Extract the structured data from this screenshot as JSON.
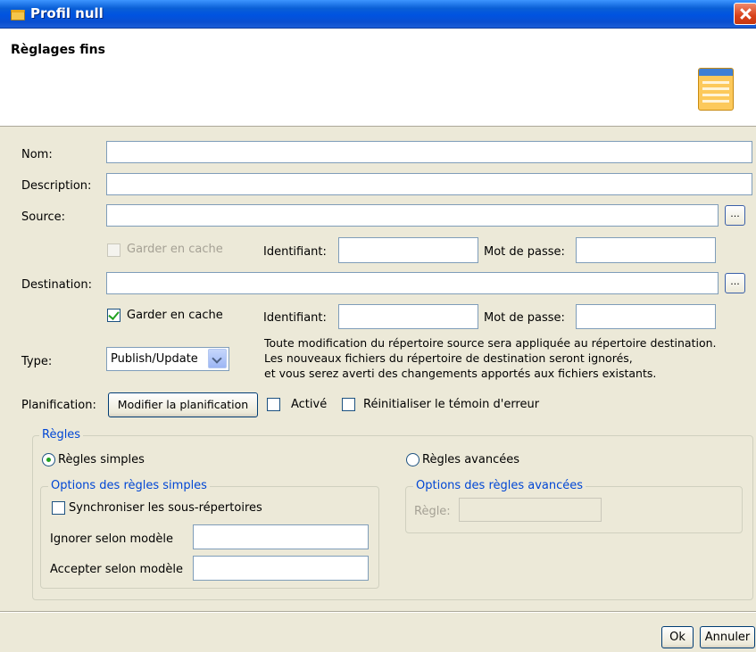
{
  "window": {
    "title": "Profil null"
  },
  "header": {
    "title": "Règlages fins",
    "icon": "profile-settings-icon"
  },
  "form": {
    "name_label": "Nom:",
    "name_value": "",
    "description_label": "Description:",
    "description_value": "",
    "source_label": "Source:",
    "source_value": "",
    "source_browse": "...",
    "source_cache_label": "Garder en cache",
    "source_cache_checked": false,
    "source_cache_enabled": false,
    "source_id_label": "Identifiant:",
    "source_id_value": "",
    "source_pwd_label": "Mot de passe:",
    "source_pwd_value": "",
    "destination_label": "Destination:",
    "destination_value": "",
    "destination_browse": "...",
    "dest_cache_label": "Garder en cache",
    "dest_cache_checked": true,
    "dest_id_label": "Identifiant:",
    "dest_id_value": "",
    "dest_pwd_label": "Mot de passe:",
    "dest_pwd_value": "",
    "type_label": "Type:",
    "type_value": "Publish/Update",
    "type_desc_1": "Toute modification du répertoire source sera appliquée au répertoire destination.",
    "type_desc_2": "Les nouveaux fichiers du répertoire de destination seront ignorés,",
    "type_desc_3": "et vous serez averti des changements apportés aux fichiers existants.",
    "schedule_label": "Planification:",
    "schedule_button": "Modifier la planification",
    "enabled_label": "Activé",
    "enabled_checked": false,
    "reset_label": "Réinitialiser le témoin d'erreur",
    "reset_checked": false
  },
  "rules": {
    "group_label": "Règles",
    "simple_radio": "Règles simples",
    "simple_selected": true,
    "advanced_radio": "Règles avancées",
    "advanced_selected": false,
    "simple_options": {
      "group_label": "Options des règles simples",
      "sync_label": "Synchroniser les sous-répertoires",
      "sync_checked": false,
      "ignore_label": "Ignorer selon modèle",
      "ignore_value": "",
      "accept_label": "Accepter selon modèle",
      "accept_value": ""
    },
    "advanced_options": {
      "group_label": "Options des règles avancées",
      "rule_label": "Règle:",
      "rule_value": ""
    }
  },
  "buttons": {
    "ok": "Ok",
    "cancel": "Annuler"
  }
}
